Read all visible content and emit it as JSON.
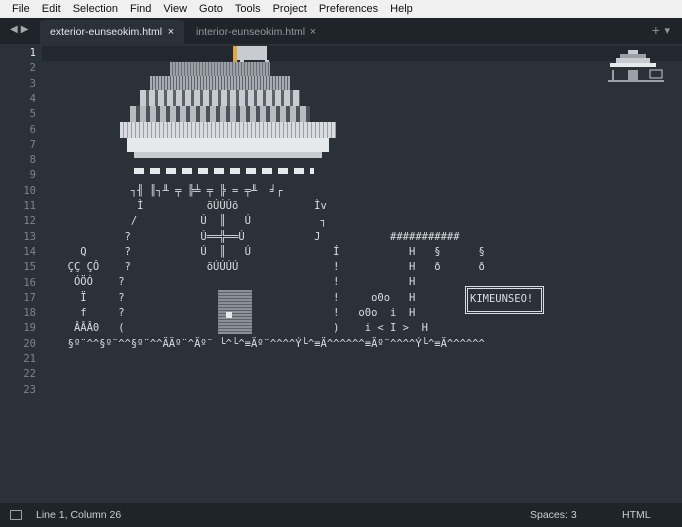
{
  "menu": [
    "File",
    "Edit",
    "Selection",
    "Find",
    "View",
    "Goto",
    "Tools",
    "Project",
    "Preferences",
    "Help"
  ],
  "tabs": [
    {
      "label": "exterior-eunseokim.html",
      "close": "×"
    },
    {
      "label": "interior-eunseokim.html",
      "close": "×"
    }
  ],
  "tabnav": "◀▶",
  "tabctrl": "+▾",
  "line_numbers": [
    "1",
    "2",
    "3",
    "4",
    "5",
    "6",
    "7",
    "8",
    "9",
    "10",
    "11",
    "12",
    "13",
    "14",
    "15",
    "16",
    "17",
    "18",
    "19",
    "20",
    "21",
    "22",
    "23"
  ],
  "code_lines": [
    "",
    "",
    "",
    "",
    "",
    "",
    "",
    "",
    "",
    "            ┐╢ ║┐╨ ╤ ╠╧ ╤ ╠ = ╤╨  ╛┌",
    "             Ì          õÚÚÚõ            Ìv",
    "            /          Ú  ║   Ú           ┐",
    "           ?           Ú══╬══Ú           J           ###########",
    "    Q      ?           Ú  ║   Ú             Í           H   §      §",
    "  ÇÇ ÇÔ    ?            õÚÚÚÚ               !           H   ð      ð",
    "   ÓÖÓ    ?                                 !           H",
    "    Ï     ?                                 !     o0o   H",
    "    f     ?                                 !   o0o  i  H",
    "   ÂÂÂ0   (                                 )    i < I >  H",
    "  §º¨^^§º¨^^§º¨^^ÄÄº¨^Äº¨ └^└^≡Äº¨^^^^Ý└^≡Ä^^^^^^≡Äº¨^^^^Ý└^≡Ä^^^^^^",
    "",
    "",
    ""
  ],
  "sign_text": "KIMEUNSEO!",
  "status": {
    "position": "Line 1, Column 26",
    "spaces": "Spaces: 3",
    "syntax": "HTML"
  }
}
